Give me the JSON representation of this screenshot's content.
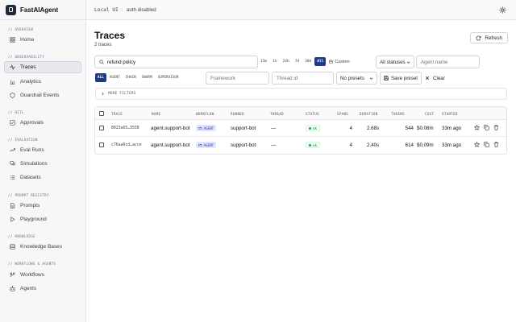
{
  "brand": {
    "name": "FastAIAgent"
  },
  "sidebar": {
    "sections": [
      {
        "label": "// OVERVIEW",
        "items": [
          {
            "label": "Home",
            "icon": "grid-icon"
          }
        ]
      },
      {
        "label": "// OBSERVABILITY",
        "items": [
          {
            "label": "Traces",
            "icon": "activity-icon",
            "active": true
          },
          {
            "label": "Analytics",
            "icon": "bar-chart-icon"
          },
          {
            "label": "Guardrail Events",
            "icon": "shield-icon"
          }
        ]
      },
      {
        "label": "// HITL",
        "items": [
          {
            "label": "Approvals",
            "icon": "check-square-icon"
          }
        ]
      },
      {
        "label": "// EVALUATION",
        "items": [
          {
            "label": "Eval Runs",
            "icon": "trend-icon"
          },
          {
            "label": "Simulations",
            "icon": "chat-icon"
          },
          {
            "label": "Datasets",
            "icon": "list-icon"
          }
        ]
      },
      {
        "label": "// PROMPT REGISTRY",
        "items": [
          {
            "label": "Prompts",
            "icon": "file-icon"
          },
          {
            "label": "Playground",
            "icon": "play-icon"
          }
        ]
      },
      {
        "label": "// KNOWLEDGE",
        "items": [
          {
            "label": "Knowledge Bases",
            "icon": "database-icon"
          }
        ]
      },
      {
        "label": "// WORKFLOWS & AGENTS",
        "items": [
          {
            "label": "Workflows",
            "icon": "workflow-icon"
          },
          {
            "label": "Agents",
            "icon": "bot-icon"
          }
        ]
      }
    ]
  },
  "topbar": {
    "env": "Local UI",
    "sep": "·",
    "auth": "auth disabled"
  },
  "page": {
    "title": "Traces",
    "subtitle": "2 traces",
    "refresh_label": "Refresh"
  },
  "filters": {
    "search_value": "refund policy",
    "time_ranges": [
      "15m",
      "1h",
      "24h",
      "7d",
      "30d",
      "All"
    ],
    "time_active": "All",
    "custom_label": "Custom",
    "status_value": "All statuses",
    "agent_placeholder": "Agent name",
    "kinds": [
      "ALL",
      "AGENT",
      "CHAIN",
      "SWARM",
      "SUPERVISOR"
    ],
    "kind_active": "ALL",
    "framework_placeholder": "Framework",
    "thread_placeholder": "Thread id",
    "presets_value": "No presets",
    "save_preset_label": "Save preset",
    "clear_label": "Clear",
    "more_filters_label": "MORE FILTERS"
  },
  "table": {
    "headers": [
      "TRACE",
      "NAME",
      "WORKFLOW",
      "RUNNER",
      "THREAD",
      "STATUS",
      "SPANS",
      "DURATION",
      "TOKENS",
      "COST",
      "STARTED"
    ],
    "rows": [
      {
        "trace": "8023a65…3558",
        "name": "agent.support-bot",
        "workflow": "AGENT",
        "runner": "support-bot",
        "thread": "—",
        "status": "ok",
        "spans": "4",
        "duration": "2.68s",
        "tokens": "544",
        "cost": "$0.08m",
        "started": "33m ago"
      },
      {
        "trace": "c76aa6cd…acce",
        "name": "agent.support-bot",
        "workflow": "AGENT",
        "runner": "support-bot",
        "thread": "—",
        "status": "ok",
        "spans": "4",
        "duration": "2.40s",
        "tokens": "614",
        "cost": "$0.09m",
        "started": "33m ago"
      }
    ]
  },
  "colors": {
    "accent": "#1e3a8a",
    "ok": "#16a34a",
    "badge_bg": "#e0e7ff"
  }
}
